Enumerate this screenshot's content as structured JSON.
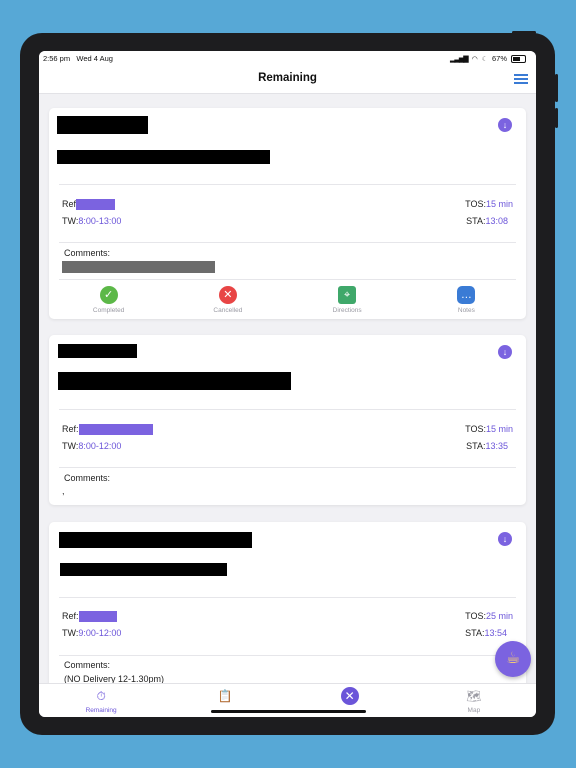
{
  "status_bar": {
    "time": "2:56 pm",
    "date": "Wed 4 Aug",
    "battery": "67%"
  },
  "nav": {
    "title": "Remaining"
  },
  "cards": [
    {
      "ref_label": "Ref",
      "tos_label": "TOS:",
      "tos_value": "15 min",
      "tw_label": "TW:",
      "tw_value": "8:00-13:00",
      "sta_label": "STA:",
      "sta_value": "13:08",
      "comments_label": "Comments:",
      "comment_text": "",
      "actions": [
        {
          "label": "Completed",
          "icon": "check-circle-icon",
          "color": "#5cb848"
        },
        {
          "label": "Cancelled",
          "icon": "x-circle-icon",
          "color": "#e84545"
        },
        {
          "label": "Directions",
          "icon": "map-pin-icon",
          "color": "#3fa86a"
        },
        {
          "label": "Notes",
          "icon": "chat-bubble-icon",
          "color": "#3a7bd5"
        }
      ]
    },
    {
      "ref_label": "Ref:",
      "tos_label": "TOS:",
      "tos_value": "15 min",
      "tw_label": "TW:",
      "tw_value": "8:00-12:00",
      "sta_label": "STA:",
      "sta_value": "13:35",
      "comments_label": "Comments:",
      "comment_text": ","
    },
    {
      "ref_label": "Ref:",
      "tos_label": "TOS:",
      "tos_value": "25 min",
      "tw_label": "TW:",
      "tw_value": "9:00-12:00",
      "sta_label": "STA:",
      "sta_value": "13:54",
      "comments_label": "Comments:",
      "comment_text": "(NO Delivery 12-1.30pm)"
    }
  ],
  "tab_bar": {
    "items": [
      {
        "label": "Remaining",
        "icon": "stopwatch-icon"
      },
      {
        "label": "",
        "icon": "clipboard-check-icon"
      },
      {
        "label": "",
        "icon": "x-circle-icon"
      },
      {
        "label": "Map",
        "icon": "map-icon"
      }
    ]
  },
  "colors": {
    "accent": "#6b55d9",
    "background": "#57a8d6"
  }
}
